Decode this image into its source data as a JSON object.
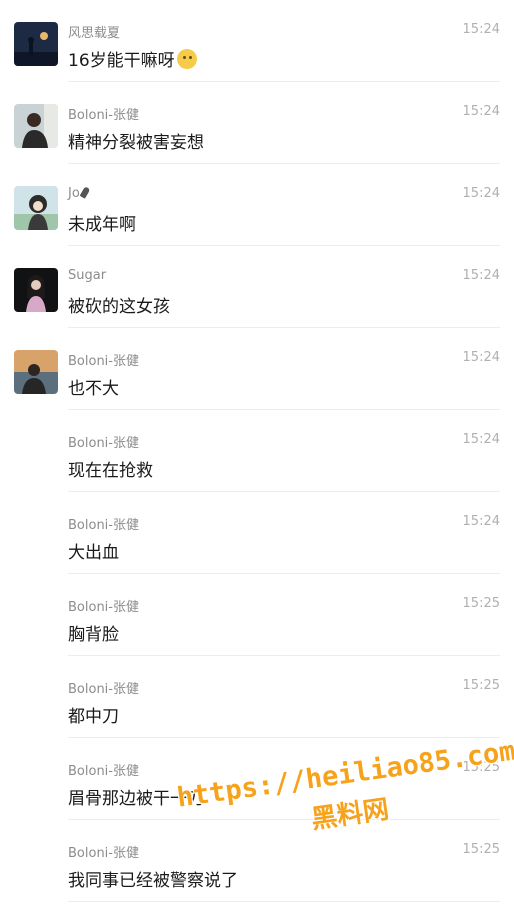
{
  "messages": [
    {
      "sender": "风思载夏",
      "text": "16岁能干嘛呀",
      "time": "15:24",
      "avatar": "night-sky-avatar",
      "emoji": "shushing-face-emoji"
    },
    {
      "sender": "Boloni-张健",
      "text": "精神分裂被害妄想",
      "time": "15:24",
      "avatar": "person-photo-avatar"
    },
    {
      "sender": "Jo",
      "text": "未成年啊",
      "time": "15:24",
      "avatar": "anime-girl-avatar",
      "sender_icon": "microphone-icon"
    },
    {
      "sender": "Sugar",
      "text": "被砍的这女孩",
      "time": "15:24",
      "avatar": "dark-portrait-avatar"
    },
    {
      "sender": "Boloni-张健",
      "text": "也不大",
      "time": "15:24",
      "avatar": "sunset-person-avatar"
    },
    {
      "sender": "Boloni-张健",
      "text": "现在在抢救",
      "time": "15:24"
    },
    {
      "sender": "Boloni-张健",
      "text": "大出血",
      "time": "15:24"
    },
    {
      "sender": "Boloni-张健",
      "text": "胸背脸",
      "time": "15:25"
    },
    {
      "sender": "Boloni-张健",
      "text": "都中刀",
      "time": "15:25"
    },
    {
      "sender": "Boloni-张健",
      "text": "眉骨那边被干一刀",
      "time": "15:25"
    },
    {
      "sender": "Boloni-张健",
      "text": "我同事已经被警察说了",
      "time": "15:25"
    }
  ],
  "watermark": {
    "url": "https://heiliao85.com",
    "name": "黑料网"
  },
  "colors": {
    "sender": "#8c8c8c",
    "time": "#b0b0b0",
    "message": "#1a1a1a",
    "divider": "#ececec",
    "watermark": "#f7a21b"
  }
}
